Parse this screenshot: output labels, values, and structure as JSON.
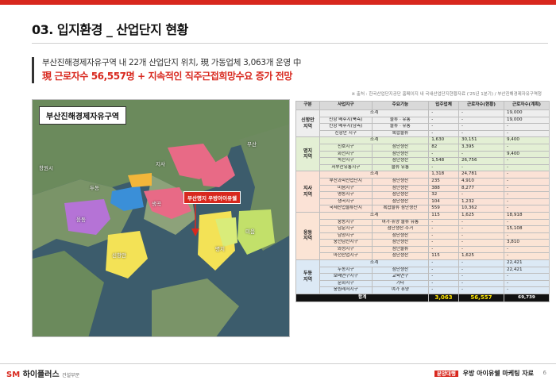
{
  "header": {
    "title": "03. 입지환경 _ 산업단지 현황",
    "summary_line1": "부산진해경제자유구역 내 22개 산업단지 위치, 現 가동업체 3,063개 운영 中",
    "summary_line2": "現 근로자수 56,557명 + 지속적인 직주근접희망수요 증가 전망",
    "source": "※ 출처 : 한국산업단지공단 홈페이지 내 국내산업단지현황자료 ('25년 1분기) / 부산진해경제자유구역청"
  },
  "map": {
    "title": "부산진해경제자유구역",
    "callout": "부산명지 우방아이유쉘",
    "places": [
      "창원시",
      "두동",
      "웅동",
      "지사",
      "부산",
      "신항만",
      "명지",
      "미음",
      "생곡"
    ]
  },
  "table": {
    "headers": [
      "구분",
      "사업지구",
      "주요기능",
      "입주업체",
      "근로자수(현황)",
      "근로자수(계획)"
    ],
    "sections": [
      {
        "group": "신항만\n지역",
        "subtotal": [
          "소계",
          "",
          "-",
          "-",
          "19,000"
        ],
        "rows": [
          [
            "신항 배후지(북측)",
            "물류 · 유통",
            "-",
            "-",
            "19,000"
          ],
          [
            "신항 배후지(남측)",
            "물류 · 유통",
            "-",
            "-",
            "-"
          ],
          [
            "신항만 지구",
            "복합물류",
            "-",
            "-",
            "-"
          ]
        ]
      },
      {
        "group": "명지\n지역",
        "subtotal": [
          "소계",
          "",
          "1,630",
          "30,151",
          "9,400"
        ],
        "rows": [
          [
            "신호지구",
            "첨단생산",
            "82",
            "3,395",
            "-"
          ],
          [
            "화전지구",
            "첨단생산",
            "-",
            "-",
            "9,400"
          ],
          [
            "녹산지구",
            "첨단생산",
            "1,548",
            "26,756",
            "-"
          ],
          [
            "서부산유통지구",
            "물류 유통",
            "-",
            "-",
            "-"
          ]
        ]
      },
      {
        "group": "지사\n지역",
        "subtotal": [
          "소계",
          "",
          "1,318",
          "24,781",
          "-"
        ],
        "rows": [
          [
            "부산과학산업단지",
            "첨단생산",
            "235",
            "4,910",
            "-"
          ],
          [
            "미음지구",
            "첨단생산",
            "388",
            "8,277",
            "-"
          ],
          [
            "명동지구",
            "첨단생산",
            "32",
            "-",
            "-"
          ],
          [
            "생곡지구",
            "첨단생산",
            "104",
            "1,232",
            "-"
          ],
          [
            "국제산업물류단지",
            "복합물류 첨단생산",
            "559",
            "10,362",
            "-"
          ]
        ]
      },
      {
        "group": "웅동\n지역",
        "subtotal": [
          "소계",
          "",
          "115",
          "1,625",
          "18,918"
        ],
        "rows": [
          [
            "웅동지구",
            "여가·휴양 물류 유통",
            "-",
            "-",
            "-"
          ],
          [
            "남문지구",
            "첨단생산·주거",
            "-",
            "-",
            "15,108"
          ],
          [
            "남양지구",
            "첨단생산",
            "-",
            "-",
            "-"
          ],
          [
            "웅천남산지구",
            "첨단생산",
            "-",
            "-",
            "3,810"
          ],
          [
            "와성지구",
            "첨단물류",
            "-",
            "-",
            "-"
          ],
          [
            "마천산업지구",
            "첨단생산",
            "115",
            "1,625",
            "-"
          ]
        ]
      },
      {
        "group": "두동\n지역",
        "subtotal": [
          "소계",
          "",
          "-",
          "-",
          "22,421"
        ],
        "rows": [
          [
            "두동지구",
            "첨단생산",
            "-",
            "-",
            "22,421"
          ],
          [
            "보배연구지구",
            "교육연구",
            "-",
            "-",
            "-"
          ],
          [
            "문화지구",
            "기타",
            "-",
            "-",
            "-"
          ],
          [
            "웅원레저지구",
            "여가 휴양",
            "-",
            "-",
            "-"
          ]
        ]
      }
    ],
    "total": [
      "합계",
      "3,063",
      "56,557",
      "69,739"
    ]
  },
  "footer": {
    "logo_mark": "SM",
    "logo_text": "하이플러스",
    "logo_sub": "건설부문",
    "tag": "분양대행",
    "right_text": "우방 아이유쉘 마케팅 자료",
    "page": "6"
  }
}
